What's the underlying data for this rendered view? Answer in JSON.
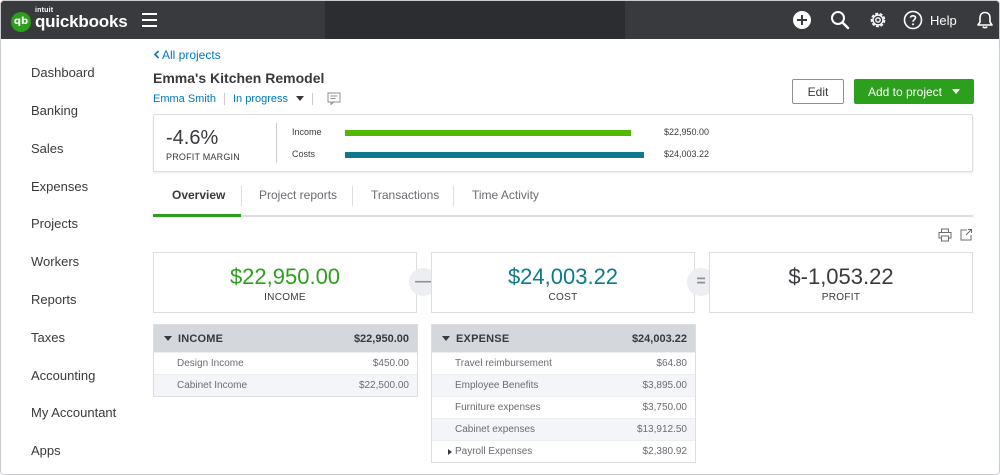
{
  "app": {
    "intuit": "intuit",
    "brand": "quickbooks",
    "logo_glyph": "qb",
    "help_label": "Help"
  },
  "sidebar": {
    "items": [
      {
        "label": "Dashboard"
      },
      {
        "label": "Banking"
      },
      {
        "label": "Sales"
      },
      {
        "label": "Expenses"
      },
      {
        "label": "Projects"
      },
      {
        "label": "Workers"
      },
      {
        "label": "Reports"
      },
      {
        "label": "Taxes"
      },
      {
        "label": "Accounting"
      },
      {
        "label": "My Accountant"
      },
      {
        "label": "Apps"
      }
    ]
  },
  "project": {
    "back_link": "All projects",
    "title": "Emma's Kitchen Remodel",
    "customer": "Emma Smith",
    "status": "In progress",
    "edit_label": "Edit",
    "add_label": "Add to project"
  },
  "summary": {
    "profit_margin_value": "-4.6%",
    "profit_margin_label": "PROFIT MARGIN",
    "income_label": "Income",
    "income_amount": "$22,950.00",
    "income_share": 0.955,
    "costs_label": "Costs",
    "costs_amount": "$24,003.22",
    "costs_share": 1.0
  },
  "tabs": [
    {
      "label": "Overview",
      "active": true
    },
    {
      "label": "Project reports",
      "active": false
    },
    {
      "label": "Transactions",
      "active": false
    },
    {
      "label": "Time Activity",
      "active": false
    }
  ],
  "kpis": {
    "income": {
      "value": "$22,950.00",
      "label": "INCOME"
    },
    "cost": {
      "value": "$24,003.22",
      "label": "COST"
    },
    "profit": {
      "value": "$-1,053.22",
      "label": "PROFIT"
    }
  },
  "income_table": {
    "title": "INCOME",
    "total": "$22,950.00",
    "rows": [
      {
        "name": "Design Income",
        "amount": "$450.00"
      },
      {
        "name": "Cabinet Income",
        "amount": "$22,500.00"
      }
    ]
  },
  "expense_table": {
    "title": "EXPENSE",
    "total": "$24,003.22",
    "rows": [
      {
        "name": "Travel reimbursement",
        "amount": "$64.80"
      },
      {
        "name": "Employee Benefits",
        "amount": "$3,895.00"
      },
      {
        "name": "Furniture expenses",
        "amount": "$3,750.00"
      },
      {
        "name": "Cabinet expenses",
        "amount": "$13,912.50"
      },
      {
        "name": "Payroll Expenses",
        "amount": "$2,380.92"
      }
    ]
  },
  "colors": {
    "brand_green": "#2ca01c",
    "cost_teal": "#0d7a8c",
    "link_blue": "#0077c5",
    "topbar": "#393a3d"
  }
}
